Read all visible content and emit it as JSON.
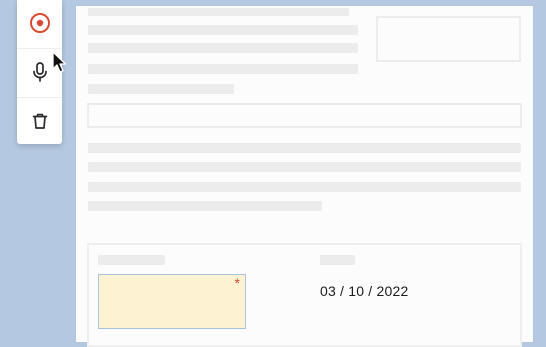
{
  "form": {
    "date_value": "03 / 10 / 2022",
    "signature_required_marker": "*"
  },
  "toolbar": {
    "tools": [
      {
        "name": "record",
        "icon": "record-icon",
        "active": true
      },
      {
        "name": "microphone",
        "icon": "microphone-icon",
        "active": false
      },
      {
        "name": "delete",
        "icon": "trash-icon",
        "active": false
      }
    ]
  },
  "colors": {
    "background": "#b4c8e1",
    "record_accent": "#d84a32",
    "signature_fill": "#fdf3d2",
    "required_marker": "#d04a3a"
  }
}
